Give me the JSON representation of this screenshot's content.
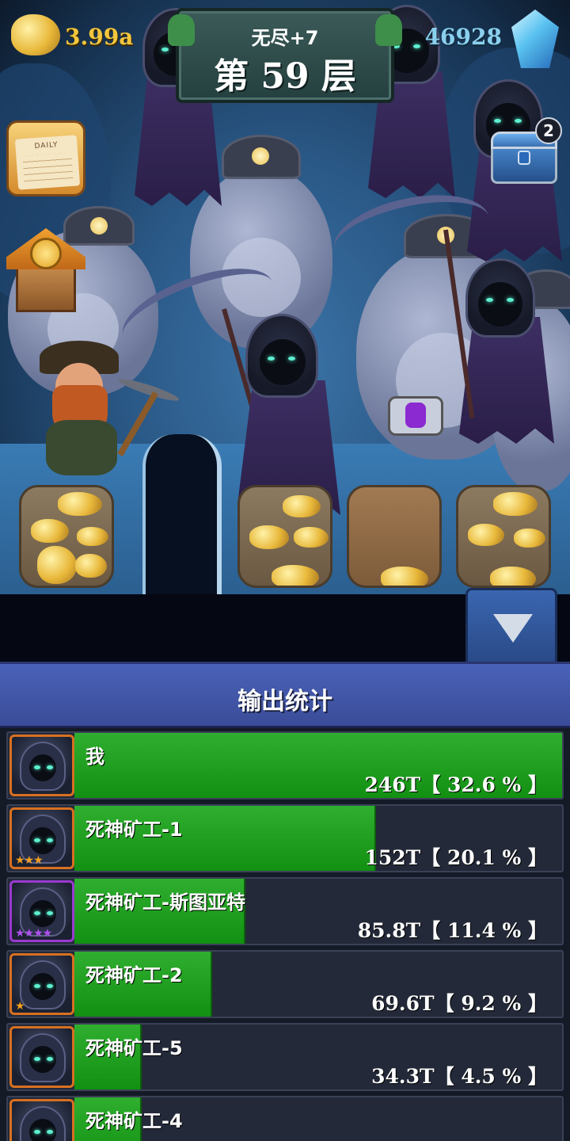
{
  "hud": {
    "gold": "3.99a",
    "gems": "46928",
    "floor_mode": "无尽+7",
    "floor_label": "第 59 层",
    "chest_badge": "2",
    "daily_label": "DAILY"
  },
  "stats": {
    "title": "输出统计",
    "rows": [
      {
        "name": "我",
        "value": "246T【 32.6 % 】",
        "percent": 32.6,
        "stars": "",
        "frame": "orange"
      },
      {
        "name": "死神矿工-1",
        "value": "152T【 20.1 % 】",
        "percent": 20.1,
        "stars": "★★★",
        "frame": "orange"
      },
      {
        "name": "死神矿工-斯图亚特",
        "value": "85.8T【 11.4 % 】",
        "percent": 11.4,
        "stars": "★★★★",
        "frame": "purple"
      },
      {
        "name": "死神矿工-2",
        "value": "69.6T【 9.2 % 】",
        "percent": 9.2,
        "stars": "★",
        "frame": "orange"
      },
      {
        "name": "死神矿工-5",
        "value": "34.3T【 4.5 % 】",
        "percent": 4.5,
        "stars": "",
        "frame": "orange"
      },
      {
        "name": "死神矿工-4",
        "value": "",
        "percent": 4.5,
        "stars": "",
        "frame": "orange"
      }
    ]
  },
  "colors": {
    "bar": "#1ea01e",
    "panel_header": "#4258a8",
    "gold_text": "#f4c63c",
    "gem_text": "#8ad0ee"
  }
}
